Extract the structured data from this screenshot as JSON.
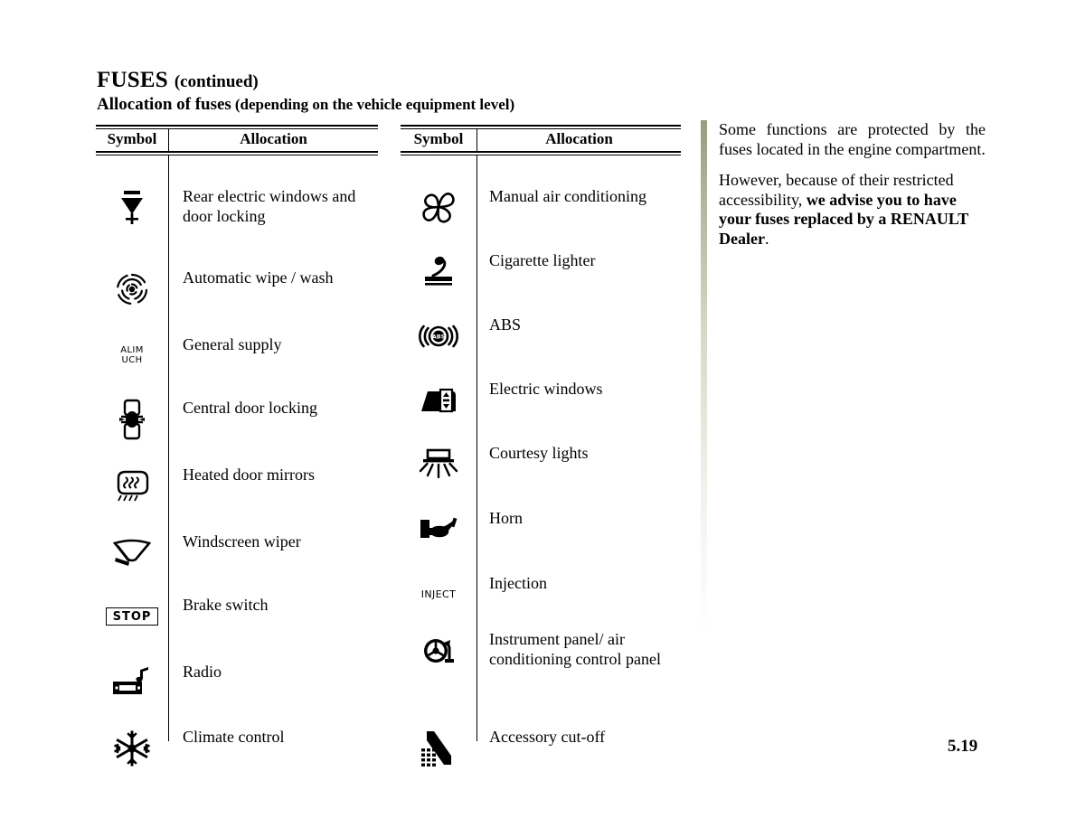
{
  "document": {
    "title_main": "FUSES",
    "title_continued": "(continued)",
    "subtitle_main": "Allocation of fuses",
    "subtitle_paren": "(depending on the vehicle equipment level)",
    "page_number": "5.19"
  },
  "table_left": {
    "headers": {
      "symbol": "Symbol",
      "allocation": "Allocation"
    },
    "rows": [
      {
        "icon": "arrow-down-bar-icon",
        "symbol_text": "",
        "allocation": "Rear electric windows and door locking"
      },
      {
        "icon": "rain-sensor-icon",
        "symbol_text": "",
        "allocation": "Automatic wipe / wash"
      },
      {
        "icon": "alim-uch-text-icon",
        "symbol_text": "ALIM UCH",
        "allocation": "General supply"
      },
      {
        "icon": "central-door-locking-icon",
        "symbol_text": "",
        "allocation": "Central door locking"
      },
      {
        "icon": "heated-mirror-icon",
        "symbol_text": "",
        "allocation": "Heated door mirrors"
      },
      {
        "icon": "windscreen-wiper-icon",
        "symbol_text": "",
        "allocation": "Windscreen wiper"
      },
      {
        "icon": "stop-badge-icon",
        "symbol_text": "STOP",
        "allocation": "Brake switch"
      },
      {
        "icon": "radio-icon",
        "symbol_text": "",
        "allocation": "Radio"
      },
      {
        "icon": "snowflake-icon",
        "symbol_text": "",
        "allocation": "Climate control"
      }
    ]
  },
  "table_right": {
    "headers": {
      "symbol": "Symbol",
      "allocation": "Allocation"
    },
    "rows": [
      {
        "icon": "fan-blower-icon",
        "symbol_text": "",
        "allocation": "Manual air conditioning"
      },
      {
        "icon": "cigarette-lighter-icon",
        "symbol_text": "",
        "allocation": "Cigarette lighter"
      },
      {
        "icon": "abs-icon",
        "symbol_text": "ABS",
        "allocation": "ABS"
      },
      {
        "icon": "electric-window-icon",
        "symbol_text": "",
        "allocation": "Electric windows"
      },
      {
        "icon": "courtesy-light-icon",
        "symbol_text": "",
        "allocation": "Courtesy lights"
      },
      {
        "icon": "horn-icon",
        "symbol_text": "",
        "allocation": "Horn"
      },
      {
        "icon": "inject-text-icon",
        "symbol_text": "INJECT",
        "allocation": "Injection"
      },
      {
        "icon": "steering-wheel-icon",
        "symbol_text": "",
        "allocation": "Instrument panel/ air conditioning control panel"
      },
      {
        "icon": "accessory-cutoff-icon",
        "symbol_text": "",
        "allocation": "Accessory cut-off"
      }
    ]
  },
  "side_note": {
    "paragraph_1": "Some functions are protected by the fuses located in the engine compartment.",
    "paragraph_2_normal": "However, because of their restricted accessibility, ",
    "paragraph_2_bold": "we advise you to have your fuses replaced by a RENAULT Dealer",
    "paragraph_2_end": ".",
    "accent_color": "#9a9b7f"
  }
}
